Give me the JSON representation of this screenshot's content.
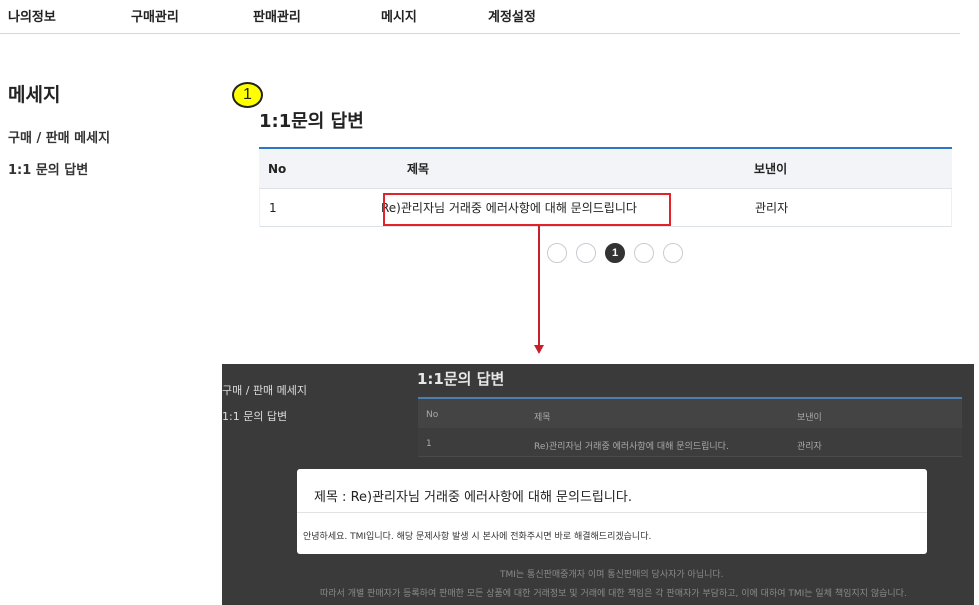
{
  "nav": {
    "items": [
      "나의정보",
      "구매관리",
      "판매관리",
      "메시지",
      "계정설정"
    ]
  },
  "sidebar": {
    "title": "메세지",
    "links": [
      "구매 / 판매 메세지",
      "1:1 문의 답변"
    ]
  },
  "step_marker": "1",
  "section_title": "1:1문의 답변",
  "table": {
    "headers": [
      "No",
      "제목",
      "보낸이"
    ],
    "rows": [
      {
        "no": "1",
        "title": "Re)관리자님 거래중 에러사항에 대해 문의드립니다",
        "sender": "관리자"
      }
    ]
  },
  "pager": {
    "pages": [
      "",
      "",
      "1",
      "",
      ""
    ],
    "active": 2
  },
  "colors": {
    "accent": "#2a78c5",
    "highlight": "#e2232a",
    "marker": "#ffff00"
  },
  "modal_screenshot": {
    "links": [
      "구매 / 판매 메세지",
      "1:1 문의 답변"
    ],
    "title": "1:1문의 답변",
    "table": {
      "headers": [
        "No",
        "제목",
        "보낸이"
      ],
      "row": {
        "no": "1",
        "title": "Re)관리자님 거래중 에러사항에 대해 문의드립니다.",
        "sender": "관리자"
      }
    },
    "modal": {
      "title": "제목 : Re)관리자님 거래중 에러사항에 대해 문의드립니다.",
      "body": "안녕하세요. TMI입니다. 해당 문제사항 발생 시 본사에 전화주시면 바로 해결해드리겠습니다."
    },
    "footer": [
      "TMI는 통신판매중개자 이며 통신판매의 당사자가 아닙니다.",
      "따라서 개별 판매자가 등록하여 판매한 모든 상품에 대한 거래정보 및 거래에 대한 책임은 각 판매자가 부담하고, 이에 대하여 TMI는 일체 책임지지 않습니다."
    ]
  }
}
